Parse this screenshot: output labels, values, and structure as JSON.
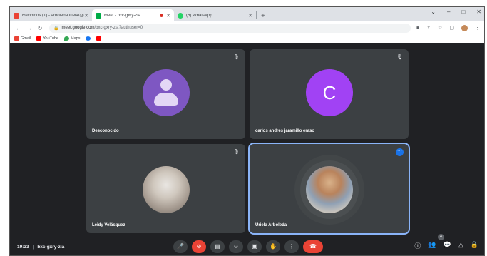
{
  "browser": {
    "tabs": [
      {
        "title": "Recibidos (1) - arboledaurielaf@g",
        "icon": "gmail-icon",
        "active": false
      },
      {
        "title": "Meet - bxc-gxry-zia",
        "icon": "meet-icon",
        "active": true
      },
      {
        "title": "(5) WhatsApp",
        "icon": "whatsapp-icon",
        "active": false
      }
    ],
    "new_tab": "+",
    "window_controls": [
      "⌄",
      "–",
      "□",
      "✕"
    ],
    "url_host": "meet.google.com",
    "url_path": "/bxc-gxry-zia?authuser=0",
    "bookmarks": [
      {
        "label": "Gmail",
        "color": "#ea4335"
      },
      {
        "label": "YouTube",
        "color": "#ff0000"
      },
      {
        "label": "Maps",
        "color": "#34a853"
      },
      {
        "label": "",
        "color": "#1877f2"
      },
      {
        "label": "",
        "color": "#ff0000"
      }
    ]
  },
  "meet": {
    "tiles": [
      {
        "name": "Desconocido",
        "avatar": "generic-person",
        "avatar_color": "#7e57c2",
        "muted": true
      },
      {
        "name": "carlos andres jaramillo eraso",
        "avatar": "letter",
        "letter": "C",
        "avatar_color": "#a142f4",
        "muted": true
      },
      {
        "name": "Leidy Velásquez",
        "avatar": "photo",
        "muted": true
      },
      {
        "name": "Uriela Arboleda",
        "avatar": "photo",
        "speaking": true
      }
    ],
    "time": "19:33",
    "separator": "|",
    "meeting_code": "bxc-gxry-zia",
    "participant_badge": "4"
  }
}
